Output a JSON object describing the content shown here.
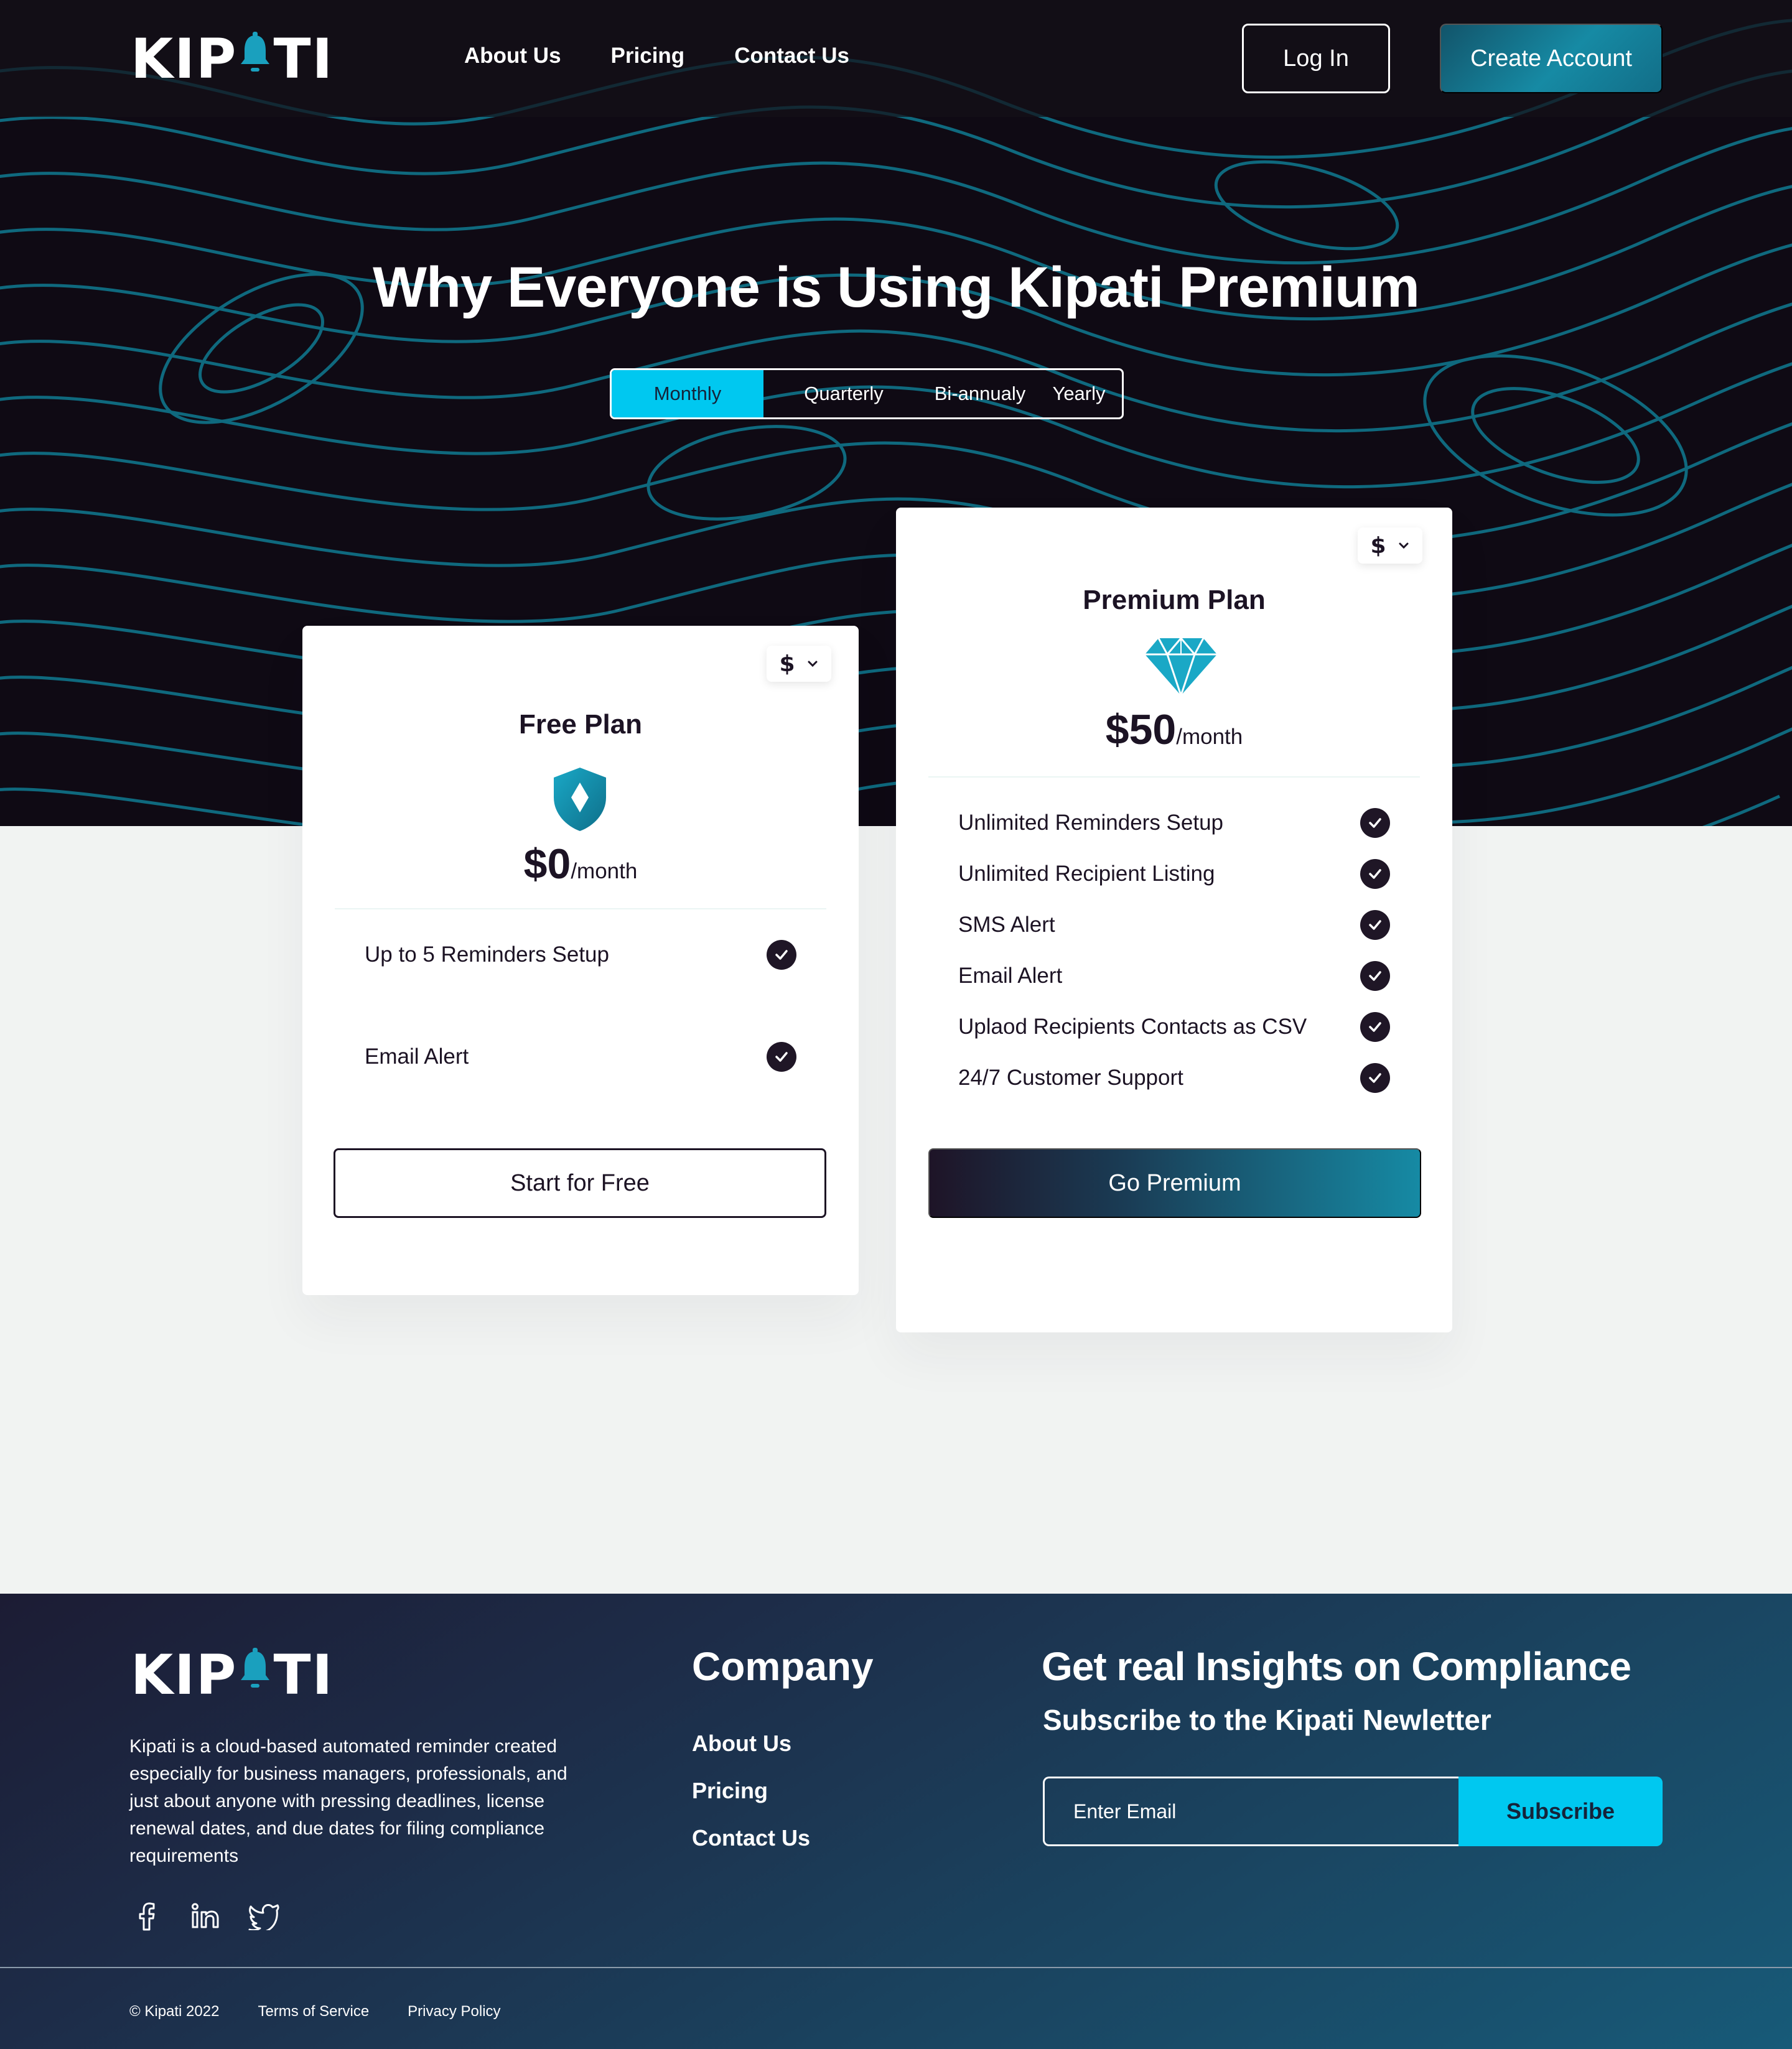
{
  "brand": {
    "name_left": "KIP",
    "name_right": "TI"
  },
  "nav": {
    "links": [
      "About Us",
      "Pricing",
      "Contact Us"
    ],
    "login_label": "Log In",
    "create_label": "Create Account"
  },
  "hero": {
    "title": "Why Everyone is Using Kipati Premium",
    "periods": [
      "Monthly",
      "Quarterly",
      "Bi-annualy",
      "Yearly"
    ],
    "active_period": "Monthly"
  },
  "plans": {
    "free": {
      "currency": "$",
      "name": "Free Plan",
      "icon": "shield-icon",
      "price": "$0",
      "per": "/month",
      "features": [
        "Up to 5 Reminders Setup",
        "Email Alert"
      ],
      "cta": "Start for Free"
    },
    "premium": {
      "currency": "$",
      "name": "Premium Plan",
      "icon": "diamond-icon",
      "price": "$50",
      "per": "/month",
      "features": [
        "Unlimited Reminders Setup",
        "Unlimited Recipient Listing",
        "SMS Alert",
        "Email Alert",
        "Uplaod Recipients Contacts as CSV",
        "24/7 Customer Support"
      ],
      "cta": "Go Premium"
    }
  },
  "footer": {
    "about": "Kipati is a cloud-based automated reminder created especially for business managers, professionals, and just about anyone with pressing deadlines, license renewal dates, and due dates for filing compliance requirements",
    "socials": [
      "facebook-icon",
      "linkedin-icon",
      "twitter-icon"
    ],
    "company_title": "Company",
    "company_links": [
      "About Us",
      "Pricing",
      "Contact Us"
    ],
    "newsletter_title": "Get real Insights on Compliance",
    "newsletter_subtitle": "Subscribe to the Kipati Newletter",
    "email_placeholder": "Enter Email",
    "subscribe_label": "Subscribe",
    "copyright": "© Kipati 2022",
    "terms": "Terms of Service",
    "privacy": "Privacy Policy"
  },
  "colors": {
    "accent": "#00c8f0",
    "teal": "#168aa4",
    "dark": "#1c1324",
    "topo_line": "#0f6f84"
  }
}
